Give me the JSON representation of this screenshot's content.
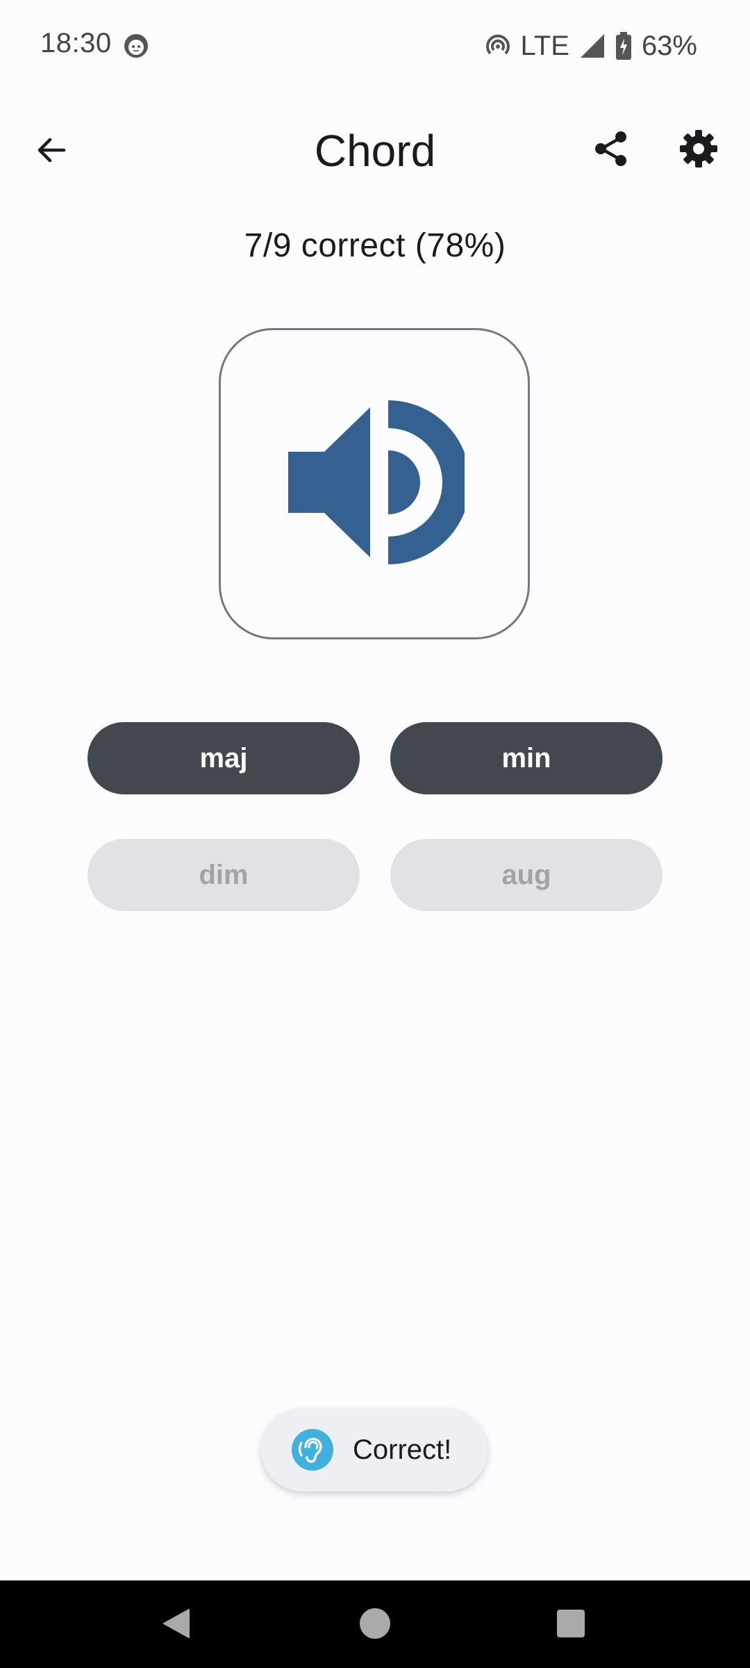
{
  "status_bar": {
    "time": "18:30",
    "network": "LTE",
    "battery": "63%",
    "icons": [
      "face-icon",
      "hotspot-icon",
      "signal-icon",
      "battery-icon"
    ]
  },
  "app_bar": {
    "title": "Chord",
    "icons": [
      "back-arrow-icon",
      "share-icon",
      "gear-icon"
    ]
  },
  "score": {
    "text": "7/9 correct (78%)"
  },
  "play": {
    "icon": "speaker-icon",
    "icon_color": "#34618f"
  },
  "answers": [
    {
      "label": "maj",
      "enabled": true
    },
    {
      "label": "min",
      "enabled": true
    },
    {
      "label": "dim",
      "enabled": false
    },
    {
      "label": "aug",
      "enabled": false
    }
  ],
  "toast": {
    "icon": "ear-icon",
    "text": "Correct!",
    "icon_color": "#42b0dc"
  },
  "colors": {
    "background": "#fcfcff",
    "button_enabled": "#43474e",
    "button_disabled": "#e2e2e6"
  }
}
